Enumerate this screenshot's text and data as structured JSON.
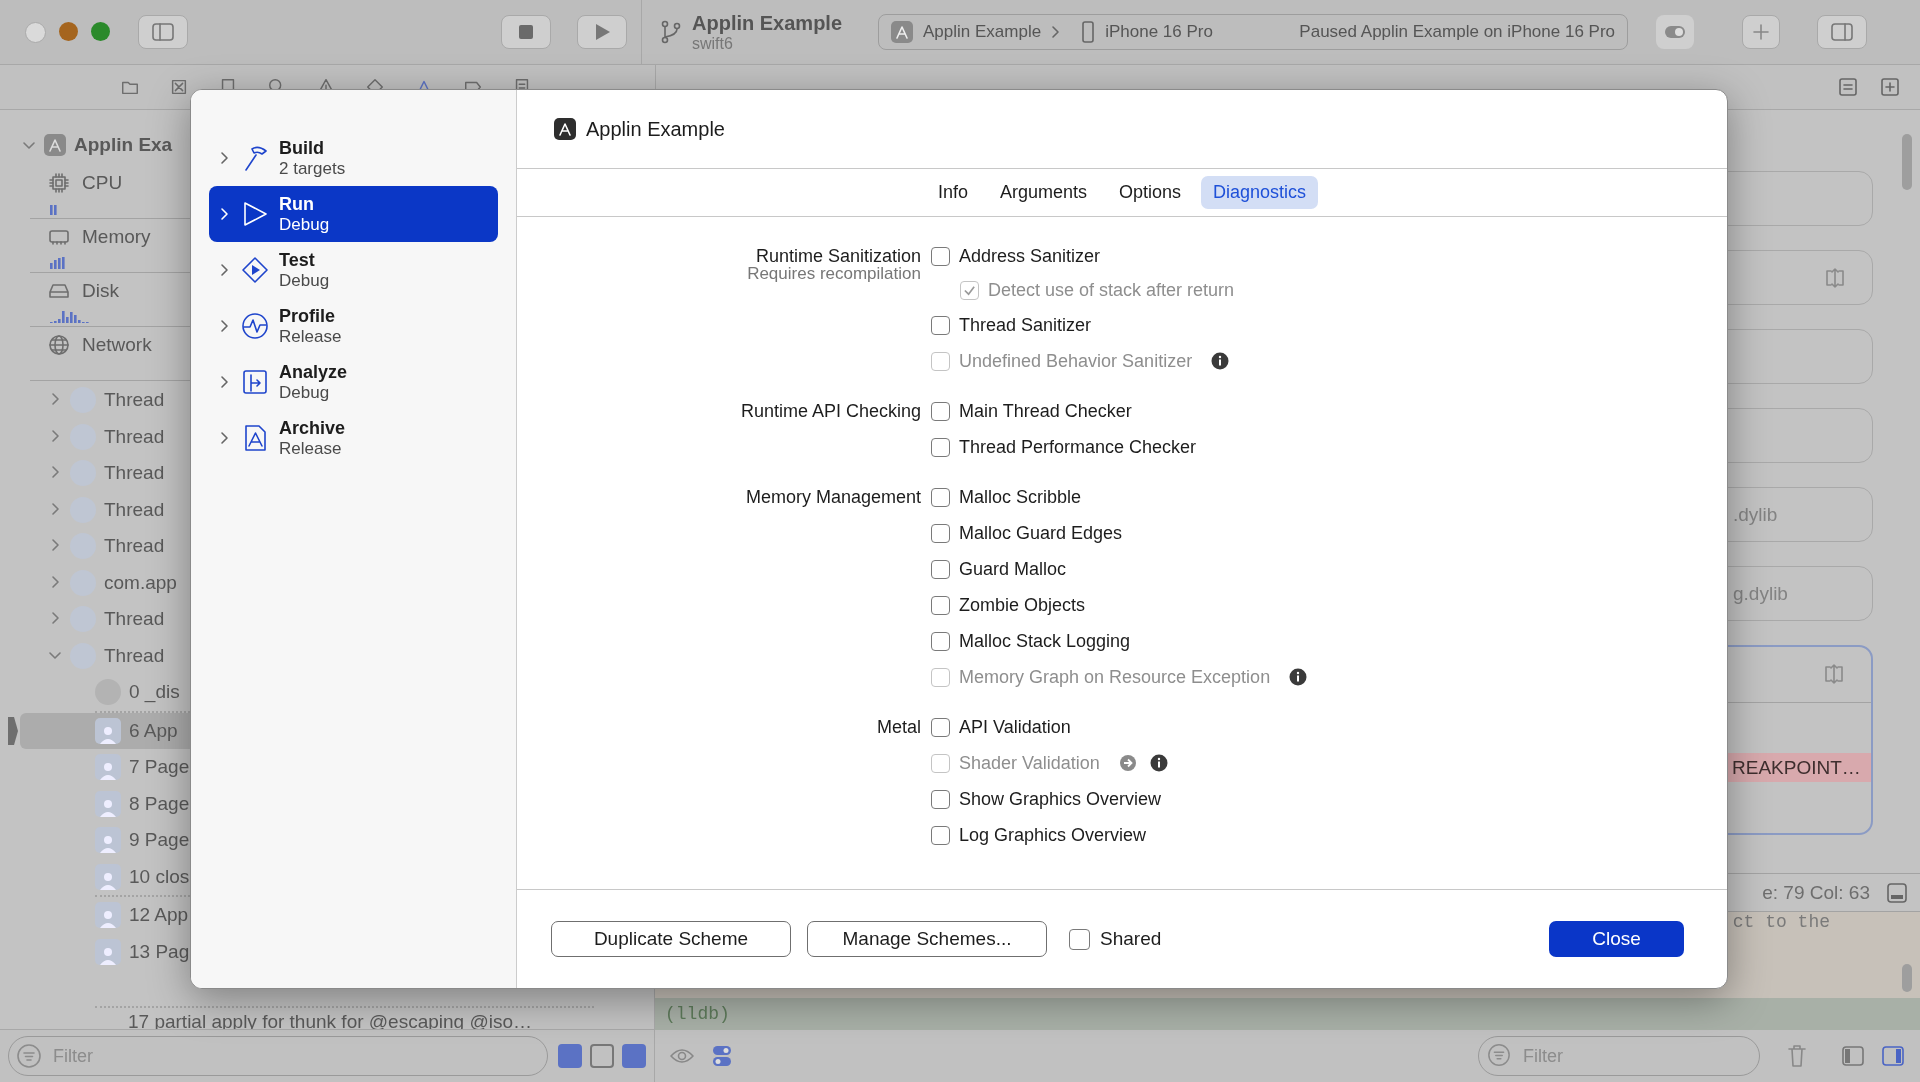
{
  "window": {
    "project": "Applin Example",
    "branch": "swift6"
  },
  "toolbar": {
    "scheme": "Applin Example",
    "device": "iPhone 16 Pro",
    "status": "Paused Applin Example on iPhone 16 Pro"
  },
  "navigator": {
    "project": "Applin Exa",
    "gauges": [
      {
        "name": "CPU",
        "kind": "cpu"
      },
      {
        "name": "Memory",
        "kind": "memory"
      },
      {
        "name": "Disk",
        "kind": "disk"
      },
      {
        "name": "Network",
        "kind": "network"
      }
    ],
    "threads": [
      {
        "label": "Thread",
        "expanded": false
      },
      {
        "label": "Thread",
        "expanded": false
      },
      {
        "label": "Thread",
        "expanded": false
      },
      {
        "label": "Thread",
        "expanded": false
      },
      {
        "label": "Thread",
        "expanded": false
      },
      {
        "label": "com.app",
        "expanded": false
      },
      {
        "label": "Thread",
        "expanded": false
      },
      {
        "label": "Thread",
        "expanded": true
      }
    ],
    "frames": [
      {
        "label": "0 _dis",
        "kind": "system",
        "selected": false
      },
      {
        "label": "6 App",
        "kind": "user",
        "selected": true
      },
      {
        "label": "7 Page",
        "kind": "user",
        "selected": false
      },
      {
        "label": "8 Page",
        "kind": "user",
        "selected": false
      },
      {
        "label": "9 Page",
        "kind": "user",
        "selected": false
      },
      {
        "label": "10 clos",
        "kind": "user",
        "selected": false
      },
      {
        "label": "12 App",
        "kind": "user",
        "selected": false
      },
      {
        "label": "13 Pag",
        "kind": "user",
        "selected": false
      },
      {
        "label": "17 partial apply for thunk for @escaping @iso…",
        "kind": "plain",
        "selected": false
      }
    ],
    "filter": {
      "placeholder": "Filter"
    }
  },
  "editor": {
    "cards": [
      {
        "kind": "plain"
      },
      {
        "kind": "expand"
      },
      {
        "kind": "plain"
      },
      {
        "kind": "plain"
      },
      {
        "kind": "plain",
        "text": ".dylib"
      },
      {
        "kind": "plain",
        "text": "g.dylib"
      },
      {
        "kind": "breakpoint",
        "text": "REAKPOINT…"
      }
    ],
    "cursor": "e: 79  Col: 63",
    "code": "ct to the",
    "console": "(lldb)",
    "filter": {
      "placeholder": "Filter"
    }
  },
  "scheme_sheet": {
    "actions": [
      {
        "name": "Build",
        "detail": "2 targets",
        "kind": "build",
        "selected": false
      },
      {
        "name": "Run",
        "detail": "Debug",
        "kind": "run",
        "selected": true
      },
      {
        "name": "Test",
        "detail": "Debug",
        "kind": "test",
        "selected": false
      },
      {
        "name": "Profile",
        "detail": "Release",
        "kind": "profile",
        "selected": false
      },
      {
        "name": "Analyze",
        "detail": "Debug",
        "kind": "analyze",
        "selected": false
      },
      {
        "name": "Archive",
        "detail": "Release",
        "kind": "archive",
        "selected": false
      }
    ],
    "title": "Applin Example",
    "tabs": [
      {
        "label": "Info",
        "selected": false
      },
      {
        "label": "Arguments",
        "selected": false
      },
      {
        "label": "Options",
        "selected": false
      },
      {
        "label": "Diagnostics",
        "selected": true
      }
    ],
    "groups": [
      {
        "label": "Runtime Sanitization",
        "note": "Requires recompilation",
        "options": [
          {
            "label": "Address Sanitizer",
            "checked": false,
            "disabled": false,
            "children": [
              {
                "label": "Detect use of stack after return",
                "checked": true,
                "disabled": true
              }
            ]
          },
          {
            "label": "Thread Sanitizer",
            "checked": false,
            "disabled": false
          },
          {
            "label": "Undefined Behavior Sanitizer",
            "checked": false,
            "disabled": true,
            "info": true
          }
        ]
      },
      {
        "label": "Runtime API Checking",
        "options": [
          {
            "label": "Main Thread Checker",
            "checked": false,
            "disabled": false
          },
          {
            "label": "Thread Performance Checker",
            "checked": false,
            "disabled": false
          }
        ]
      },
      {
        "label": "Memory Management",
        "options": [
          {
            "label": "Malloc Scribble",
            "checked": false,
            "disabled": false
          },
          {
            "label": "Malloc Guard Edges",
            "checked": false,
            "disabled": false
          },
          {
            "label": "Guard Malloc",
            "checked": false,
            "disabled": false
          },
          {
            "label": "Zombie Objects",
            "checked": false,
            "disabled": false
          },
          {
            "label": "Malloc Stack Logging",
            "checked": false,
            "disabled": false
          },
          {
            "label": "Memory Graph on Resource Exception",
            "checked": false,
            "disabled": true,
            "info": true
          }
        ]
      },
      {
        "label": "Metal",
        "options": [
          {
            "label": "API Validation",
            "checked": false,
            "disabled": false
          },
          {
            "label": "Shader Validation",
            "checked": false,
            "disabled": true,
            "link": true,
            "info": true
          },
          {
            "label": "Show Graphics Overview",
            "checked": false,
            "disabled": false
          },
          {
            "label": "Log Graphics Overview",
            "checked": false,
            "disabled": false
          }
        ]
      }
    ],
    "buttons": [
      "Duplicate Scheme",
      "Manage Schemes..."
    ],
    "shared": {
      "label": "Shared",
      "checked": false
    },
    "close": "Close"
  }
}
